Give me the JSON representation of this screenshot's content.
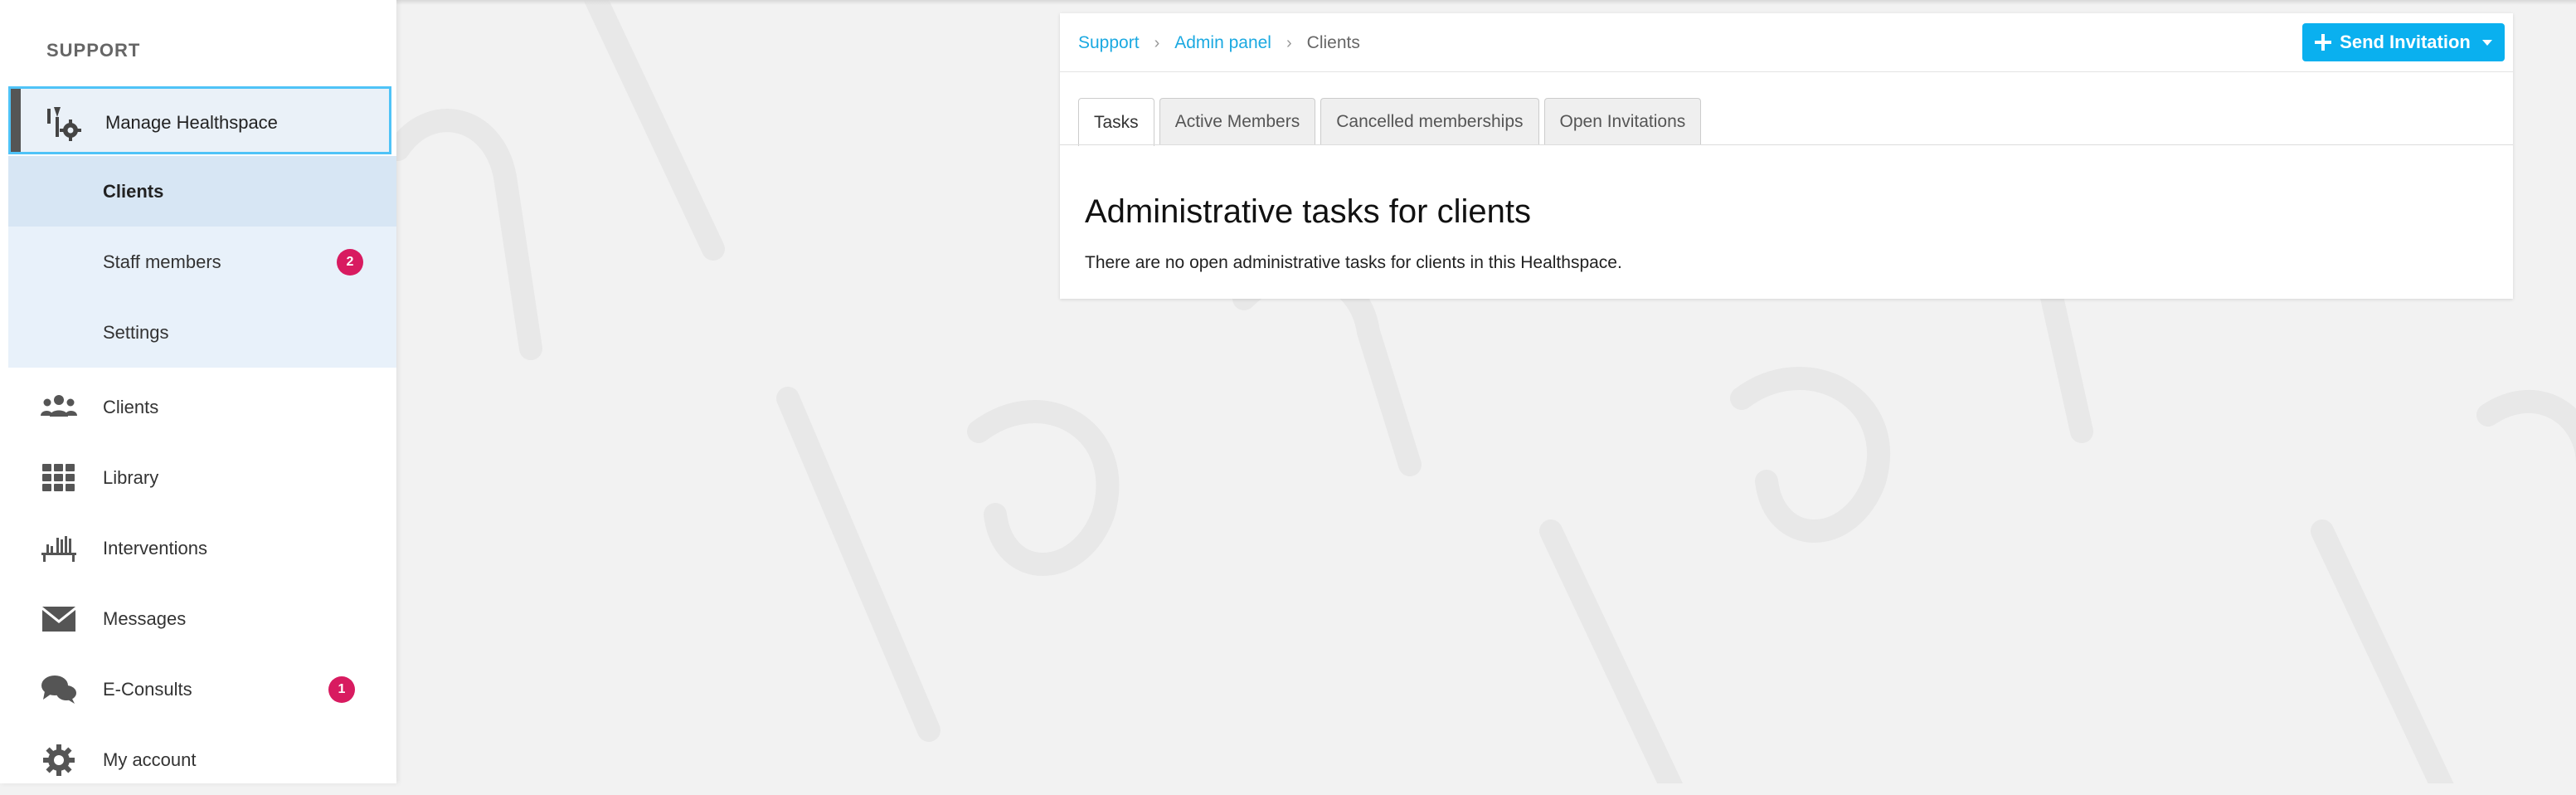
{
  "sidebar": {
    "heading": "SUPPORT",
    "active_item": {
      "label": "Manage Healthspace",
      "icon": "manage-healthspace-icon"
    },
    "sub_items": [
      {
        "label": "Clients",
        "selected": true
      },
      {
        "label": "Staff members",
        "badge": "2"
      },
      {
        "label": "Settings"
      }
    ],
    "items": [
      {
        "label": "Clients",
        "icon": "users-icon"
      },
      {
        "label": "Library",
        "icon": "grid-icon"
      },
      {
        "label": "Interventions",
        "icon": "interventions-icon"
      },
      {
        "label": "Messages",
        "icon": "envelope-icon"
      },
      {
        "label": "E-Consults",
        "icon": "chat-icon",
        "badge": "1"
      },
      {
        "label": "My account",
        "icon": "gear-icon"
      }
    ]
  },
  "breadcrumb": {
    "items": [
      "Support",
      "Admin panel"
    ],
    "current": "Clients"
  },
  "actions": {
    "send_invitation": "Send Invitation"
  },
  "tabs": [
    {
      "label": "Tasks",
      "active": true
    },
    {
      "label": "Active Members"
    },
    {
      "label": "Cancelled memberships"
    },
    {
      "label": "Open Invitations"
    }
  ],
  "content": {
    "title": "Administrative tasks for clients",
    "text": "There are no open administrative tasks for clients in this Healthspace."
  },
  "colors": {
    "accent": "#0ab0ef",
    "link": "#1ba9e1",
    "badge": "#d81b60",
    "active_border": "#4fc3f7"
  }
}
